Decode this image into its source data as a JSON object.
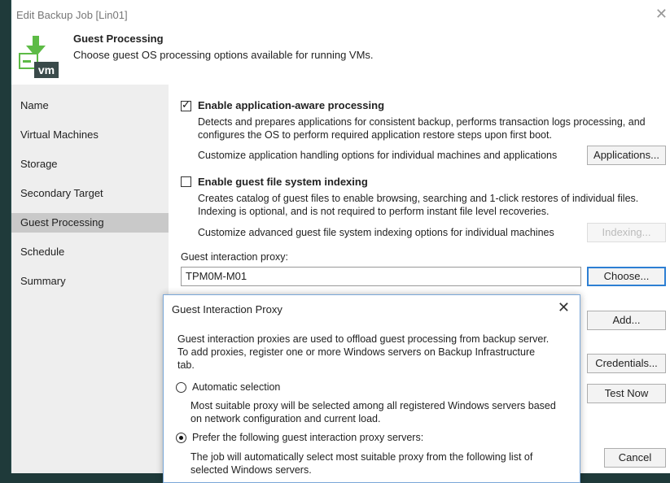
{
  "window": {
    "title": "Edit Backup Job [Lin01]",
    "close": "✕"
  },
  "header": {
    "title": "Guest Processing",
    "subtitle": "Choose guest OS processing options available for running VMs.",
    "icon_text": "vm"
  },
  "sidebar": {
    "items": [
      {
        "label": "Name",
        "active": false
      },
      {
        "label": "Virtual Machines",
        "active": false
      },
      {
        "label": "Storage",
        "active": false
      },
      {
        "label": "Secondary Target",
        "active": false
      },
      {
        "label": "Guest Processing",
        "active": true
      },
      {
        "label": "Schedule",
        "active": false
      },
      {
        "label": "Summary",
        "active": false
      }
    ]
  },
  "main": {
    "app_aware": {
      "label": "Enable application-aware processing",
      "checked": true,
      "desc1": "Detects and prepares applications for consistent backup, performs transaction logs processing, and",
      "desc2": "configures the OS to perform required application restore steps upon first boot.",
      "customize": "Customize application handling options for individual machines and applications",
      "button": "Applications..."
    },
    "indexing": {
      "label": "Enable guest file system indexing",
      "checked": false,
      "desc1": "Creates catalog of guest files to enable browsing, searching and 1-click restores of individual files.",
      "desc2": "Indexing is optional, and is not required to perform instant file level recoveries.",
      "customize": "Customize advanced guest file system indexing options for individual machines",
      "button": "Indexing..."
    },
    "proxy": {
      "label": "Guest interaction proxy:",
      "value": "TPM0M-M01",
      "button": "Choose..."
    },
    "add_button": "Add...",
    "credentials_button": "Credentials...",
    "test_button": "Test Now",
    "cancel_button": "Cancel"
  },
  "dialog": {
    "title": "Guest Interaction Proxy",
    "close": "✕",
    "intro1": "Guest interaction proxies are used to offload guest processing from backup server.",
    "intro2": "To add proxies, register one or more Windows servers on Backup Infrastructure",
    "intro3": "tab.",
    "auto": {
      "label": "Automatic selection",
      "selected": false,
      "desc1": "Most suitable proxy will be selected among all registered Windows servers based",
      "desc2": "on network configuration and current load."
    },
    "prefer": {
      "label": "Prefer the following guest interaction proxy servers:",
      "selected": true,
      "desc1": "The job will automatically select most suitable proxy from the following list of",
      "desc2": "selected Windows servers."
    }
  },
  "colors": {
    "accent": "#2d7fd3",
    "sidebar_active": "#c9c9c9",
    "icon_green": "#5dbb46",
    "icon_dark": "#3a4a4a"
  }
}
